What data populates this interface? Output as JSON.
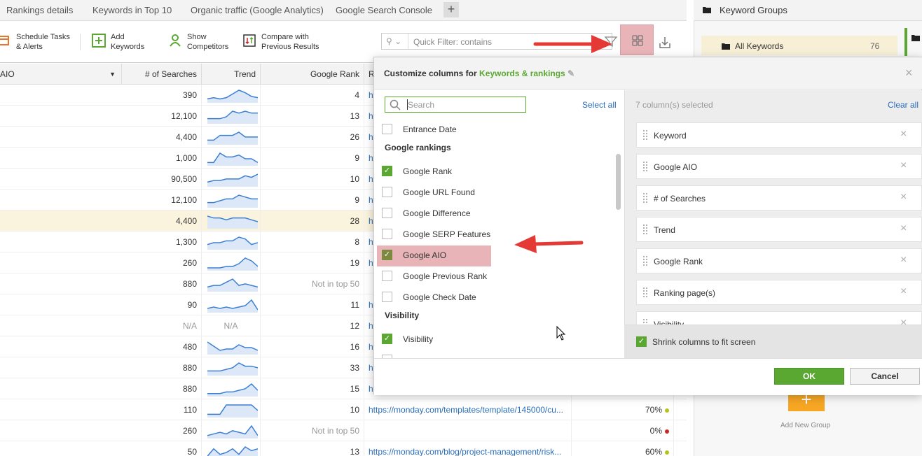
{
  "tabs": [
    {
      "label": "Rankings details"
    },
    {
      "label": "Keywords in Top 10"
    },
    {
      "label": "Organic traffic (Google Analytics)"
    },
    {
      "label": "Google Search Console"
    }
  ],
  "toolbar": {
    "schedule": "Schedule Tasks\n& Alerts",
    "schedule_l1": "Schedule Tasks",
    "schedule_l2": "& Alerts",
    "add_l1": "Add",
    "add_l2": "Keywords",
    "show_l1": "Show",
    "show_l2": "Competitors",
    "compare_l1": "Compare with",
    "compare_l2": "Previous Results",
    "quickfilter_placeholder": "Quick Filter: contains"
  },
  "table": {
    "headers": {
      "aio": "AIO",
      "searches": "# of Searches",
      "trend": "Trend",
      "rank": "Google Rank",
      "url": "R"
    },
    "rows": [
      {
        "searches": "390",
        "rank": "4",
        "url": "ht",
        "vis": "",
        "spark": [
          2,
          3,
          2,
          3,
          6,
          9,
          7,
          4,
          3
        ]
      },
      {
        "searches": "12,100",
        "rank": "13",
        "url": "ht",
        "vis": "",
        "spark": [
          2,
          2,
          2,
          3,
          6,
          5,
          6,
          5,
          5
        ]
      },
      {
        "searches": "4,400",
        "rank": "26",
        "url": "ht",
        "vis": "",
        "spark": [
          2,
          2,
          5,
          5,
          5,
          7,
          4,
          4,
          4
        ]
      },
      {
        "searches": "1,000",
        "rank": "9",
        "url": "ht",
        "vis": "",
        "spark": [
          1,
          1,
          6,
          4,
          4,
          5,
          3,
          3,
          1
        ]
      },
      {
        "searches": "90,500",
        "rank": "10",
        "url": "ht",
        "vis": "",
        "spark": [
          2,
          3,
          3,
          4,
          4,
          4,
          6,
          5,
          7
        ]
      },
      {
        "searches": "12,100",
        "rank": "9",
        "url": "ht",
        "vis": "",
        "spark": [
          2,
          2,
          3,
          4,
          4,
          6,
          5,
          4,
          4
        ]
      },
      {
        "searches": "4,400",
        "rank": "28",
        "url": "ht",
        "vis": "",
        "spark": [
          6,
          5,
          5,
          4,
          5,
          5,
          5,
          4,
          3
        ]
      },
      {
        "searches": "1,300",
        "rank": "8",
        "url": "ht",
        "vis": "",
        "spark": [
          2,
          3,
          3,
          4,
          4,
          6,
          5,
          2,
          3
        ]
      },
      {
        "searches": "260",
        "rank": "19",
        "url": "ht",
        "vis": "",
        "spark": [
          1,
          1,
          1,
          2,
          2,
          4,
          8,
          6,
          2
        ]
      },
      {
        "searches": "880",
        "rank": "Not in top 50",
        "url": "",
        "vis": "",
        "spark": [
          2,
          3,
          3,
          5,
          7,
          3,
          4,
          3,
          2
        ]
      },
      {
        "searches": "90",
        "rank": "11",
        "url": "ht",
        "vis": "",
        "spark": [
          2,
          3,
          2,
          3,
          2,
          3,
          4,
          8,
          1
        ]
      },
      {
        "searches": "N/A",
        "rank": "12",
        "url": "ht",
        "vis": "",
        "trend_text": "N/A",
        "spark": []
      },
      {
        "searches": "480",
        "rank": "16",
        "url": "ht",
        "vis": "",
        "spark": [
          8,
          5,
          2,
          3,
          3,
          6,
          4,
          4,
          2
        ]
      },
      {
        "searches": "880",
        "rank": "33",
        "url": "ht",
        "vis": "",
        "spark": [
          2,
          2,
          2,
          3,
          4,
          7,
          5,
          5,
          4
        ]
      },
      {
        "searches": "880",
        "rank": "15",
        "url": "ht",
        "vis": "",
        "spark": [
          1,
          1,
          1,
          2,
          2,
          3,
          4,
          7,
          3
        ]
      },
      {
        "searches": "110",
        "rank": "10",
        "url": "https://monday.com/templates/template/145000/cu...",
        "vis": "70%",
        "dot": "#b5c417",
        "spark": [
          1,
          1,
          1,
          6,
          6,
          6,
          6,
          6,
          3
        ]
      },
      {
        "searches": "260",
        "rank": "Not in top 50",
        "url": "",
        "vis": "0%",
        "dot": "#c62828",
        "spark": [
          1,
          2,
          3,
          2,
          4,
          3,
          2,
          7,
          1
        ]
      },
      {
        "searches": "50",
        "rank": "13",
        "url": "https://monday.com/blog/project-management/risk...",
        "vis": "60%",
        "dot": "#b5c417",
        "spark": [
          1,
          5,
          2,
          3,
          5,
          2,
          6,
          4,
          5
        ]
      }
    ]
  },
  "right_panel": {
    "title": "Keyword Groups",
    "all_label": "All Keywords",
    "all_count": "76",
    "add_group": "Add New Group"
  },
  "dialog": {
    "title_prefix": "Customize columns for",
    "project": "Keywords & rankings",
    "search_placeholder": "Search",
    "select_all": "Select all",
    "selected_count": "7 column(s) selected",
    "clear_all": "Clear all",
    "options_top": "Entrance Date",
    "group_rankings": "Google rankings",
    "options_rankings": [
      {
        "label": "Google Rank",
        "checked": true
      },
      {
        "label": "Google URL Found",
        "checked": false
      },
      {
        "label": "Google Difference",
        "checked": false
      },
      {
        "label": "Google SERP Features",
        "checked": false
      },
      {
        "label": "Google AIO",
        "checked": true
      },
      {
        "label": "Google Previous Rank",
        "checked": false
      },
      {
        "label": "Google Check Date",
        "checked": false
      }
    ],
    "group_visibility": "Visibility",
    "option_visibility": "Visibility",
    "selected": [
      "Keyword",
      "Google AIO",
      "# of Searches",
      "Trend",
      "Google Rank",
      "Ranking page(s)",
      "Visibility"
    ],
    "shrink_label": "Shrink columns to fit screen",
    "ok": "OK",
    "cancel": "Cancel"
  },
  "colors": {
    "accent_green": "#5aa832",
    "link_blue": "#2a6db8",
    "highlight": "#e8b4b8",
    "arrow_red": "#e53935"
  }
}
